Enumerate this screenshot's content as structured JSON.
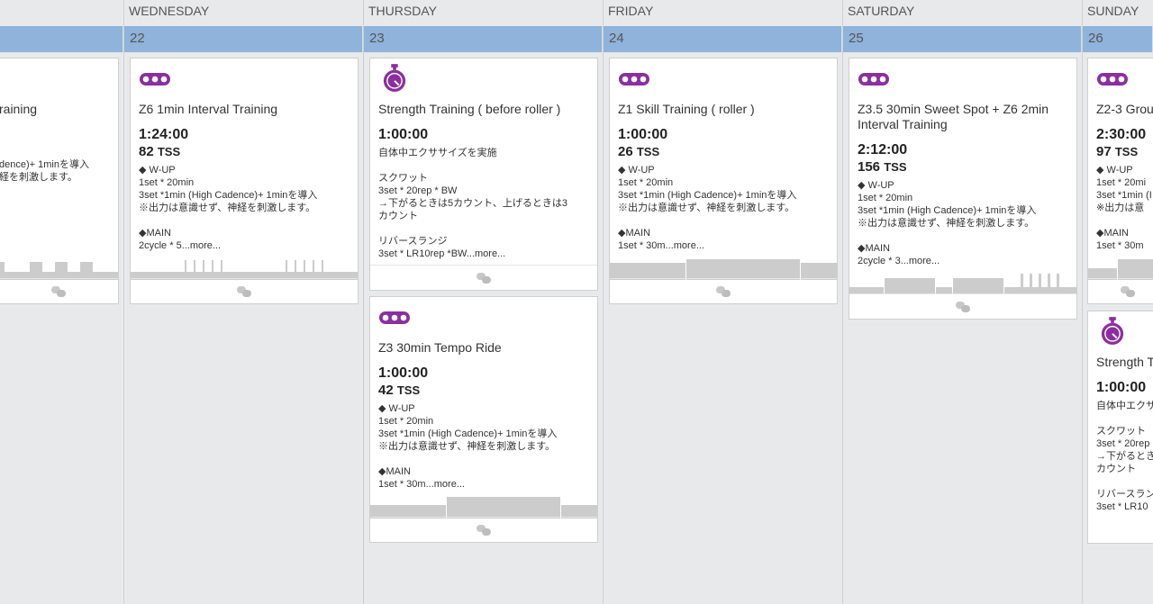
{
  "days": [
    {
      "name": "",
      "num": ""
    },
    {
      "name": "WEDNESDAY",
      "num": "22"
    },
    {
      "name": "THURSDAY",
      "num": "23"
    },
    {
      "name": "FRIDAY",
      "num": "24"
    },
    {
      "name": "SATURDAY",
      "num": "25"
    },
    {
      "name": "SUNDAY",
      "num": "26"
    }
  ],
  "workouts": {
    "tue1": {
      "title": "raining",
      "desc": "\n\n\ndence)+ 1minを導入\n経を刺激します。"
    },
    "wed1": {
      "icon": "bike-chain-icon",
      "title": "Z6 1min Interval Training",
      "duration": "1:24:00",
      "tss": "82",
      "tss_unit": "TSS",
      "desc": "◆ W-UP\n1set * 20min\n3set *1min (High Cadence)+ 1minを導入\n※出力は意識せず、神経を刺激します。\n\n◆MAIN\n2cycle * 5...more..."
    },
    "thu1": {
      "icon": "stopwatch-icon",
      "title": "Strength Training ( before roller )",
      "duration": "1:00:00",
      "desc": "自体中エクササイズを実施\n\nスクワット\n3set * 20rep * BW\n→下がるときは5カウント、上げるときは3\nカウント\n\nリバースランジ\n3set * LR10rep *BW...more..."
    },
    "thu2": {
      "icon": "bike-chain-icon",
      "title": "Z3 30min Tempo Ride",
      "duration": "1:00:00",
      "tss": "42",
      "tss_unit": "TSS",
      "desc": "◆ W-UP\n1set * 20min\n3set *1min (High Cadence)+ 1minを導入\n※出力は意識せず、神経を刺激します。\n\n◆MAIN\n1set * 30m...more..."
    },
    "fri1": {
      "icon": "bike-chain-icon",
      "title": "Z1 Skill Training ( roller )",
      "duration": "1:00:00",
      "tss": "26",
      "tss_unit": "TSS",
      "desc": "◆ W-UP\n1set * 20min\n3set *1min (High Cadence)+ 1minを導入\n※出力は意識せず、神経を刺激します。\n\n◆MAIN\n1set * 30m...more..."
    },
    "sat1": {
      "icon": "bike-chain-icon",
      "title": "Z3.5 30min Sweet Spot + Z6 2min Interval Training",
      "duration": "2:12:00",
      "tss": "156",
      "tss_unit": "TSS",
      "desc": "◆ W-UP\n1set * 20min\n3set *1min (High Cadence)+ 1minを導入\n※出力は意識せず、神経を刺激します。\n\n◆MAIN\n2cycle * 3...more..."
    },
    "sun1": {
      "icon": "bike-chain-icon",
      "title": "Z2-3 Grou",
      "duration": "2:30:00",
      "tss": "97",
      "tss_unit": "TSS",
      "desc": "◆ W-UP\n1set * 20mi\n3set *1min (I\n※出力は意\n\n◆MAIN\n1set * 30m"
    },
    "sun2": {
      "icon": "stopwatch-icon",
      "title": "Strength T",
      "duration": "1:00:00",
      "desc": "自体中エクサ\n\nスクワット\n3set * 20rep\n→下がるとき\nカウント\n\nリバースラン\n3set * LR10"
    }
  },
  "colors": {
    "accent": "#8b2f9e",
    "date_bar": "#8fb3da",
    "profile": "#cccccc"
  }
}
